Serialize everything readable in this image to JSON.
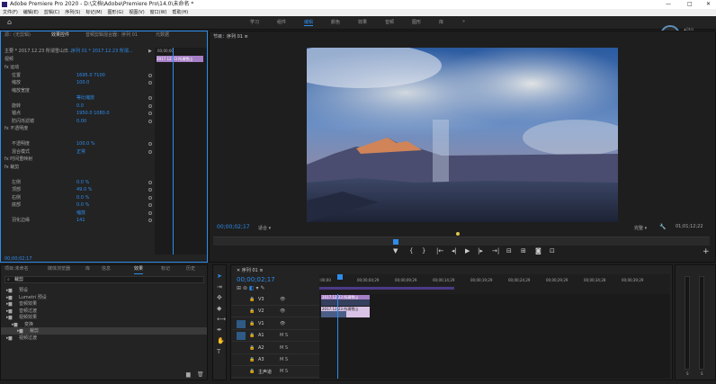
{
  "app": {
    "title": "Adobe Premiere Pro 2020 - D:\\文档\\Adobe\\Premiere Pro\\14.0\\未命名 *",
    "minimize": "—",
    "maximize": "□",
    "close": "✕"
  },
  "menu": [
    "文件(F)",
    "编辑(E)",
    "剪辑(C)",
    "序列(S)",
    "标记(M)",
    "图形(G)",
    "视图(V)",
    "窗口(W)",
    "帮助(H)"
  ],
  "workspaces": {
    "items": [
      "学习",
      "组件",
      "编辑",
      "颜色",
      "效果",
      "音频",
      "图形",
      "库"
    ],
    "active": "编辑",
    "more": "»"
  },
  "speed": {
    "value": "63",
    "unit": "%",
    "up": "0k/s",
    "down": "0k/s"
  },
  "effect_controls": {
    "tabs": [
      "源：(无剪辑)",
      "效果控件",
      "音频剪辑混合器：序列 01",
      "元数据"
    ],
    "source": "主要 * 2017.12.23 所谓雪山日...",
    "seq": "序列 01 * 2017.12.23 所谓...",
    "tl_time": "00;00;00",
    "clip_label": "2017.12.23 所谓雪山",
    "video_header": "视频",
    "rows": [
      {
        "name": "fx 运动",
        "v": ""
      },
      {
        "name": "位置",
        "v": "1695.0   7100"
      },
      {
        "name": "缩放",
        "v": "100.0"
      },
      {
        "name": "缩放宽度",
        "v": ""
      },
      {
        "name": "",
        "v": "等比缩放"
      },
      {
        "name": "旋转",
        "v": "0.0"
      },
      {
        "name": "锚点",
        "v": "1950.0   1080.0"
      },
      {
        "name": "防闪烁滤镜",
        "v": "0.00"
      },
      {
        "name": "fx 不透明度",
        "v": ""
      },
      {
        "name": "",
        "v": ""
      },
      {
        "name": "不透明度",
        "v": "100.0 %"
      },
      {
        "name": "混合模式",
        "v": "正常"
      },
      {
        "name": "fx 时间重映射",
        "v": ""
      },
      {
        "name": "fx 裁剪",
        "v": ""
      },
      {
        "name": "",
        "v": ""
      },
      {
        "name": "左侧",
        "v": "0.0 %"
      },
      {
        "name": "顶部",
        "v": "49.0 %"
      },
      {
        "name": "右侧",
        "v": "0.0 %"
      },
      {
        "name": "底部",
        "v": "0.0 %"
      },
      {
        "name": "",
        "v": "缩放"
      },
      {
        "name": "羽化边缘",
        "v": "141"
      }
    ],
    "footer_time": "00;00;02;17"
  },
  "program": {
    "title": "节目：序列 01 ≡",
    "timecode": "00;00;02;17",
    "fit": "适合",
    "quality": "完整",
    "duration": "01;01;12;22",
    "add": "+"
  },
  "project": {
    "tabs": [
      "项目:未命名",
      "媒体浏览器",
      "库",
      "信息",
      "效果",
      "标记",
      "历史"
    ],
    "search": "裁剪",
    "items": [
      "预设",
      "Lumetri 预设",
      "音频效果",
      "音频过渡",
      "视频效果",
      "变换",
      "裁剪",
      "视频过渡"
    ]
  },
  "timeline": {
    "tab": "序列 01 ≡",
    "timecode": "00;00;02;17",
    "ruler": [
      ":00;00",
      "00;00;04;29",
      "00;00;09;29",
      "00;00;14;29",
      "00;00;19;29",
      "00;00;24;29",
      "00;00;29;29",
      "00;00;34;28",
      "00;00;39;29"
    ],
    "tracks": [
      "V3",
      "V2",
      "V1",
      "A1",
      "A2",
      "A3",
      "主声道"
    ],
    "clip_v2": "2017.12.23 所谓雪山",
    "clip_v1": "2017.12.23 所谓雪山",
    "master": "0.0"
  },
  "colors": {
    "accent": "#2d8ceb",
    "clip_video": "#a67fc6",
    "clip_audio": "#2e9c75",
    "panel": "#232323"
  }
}
